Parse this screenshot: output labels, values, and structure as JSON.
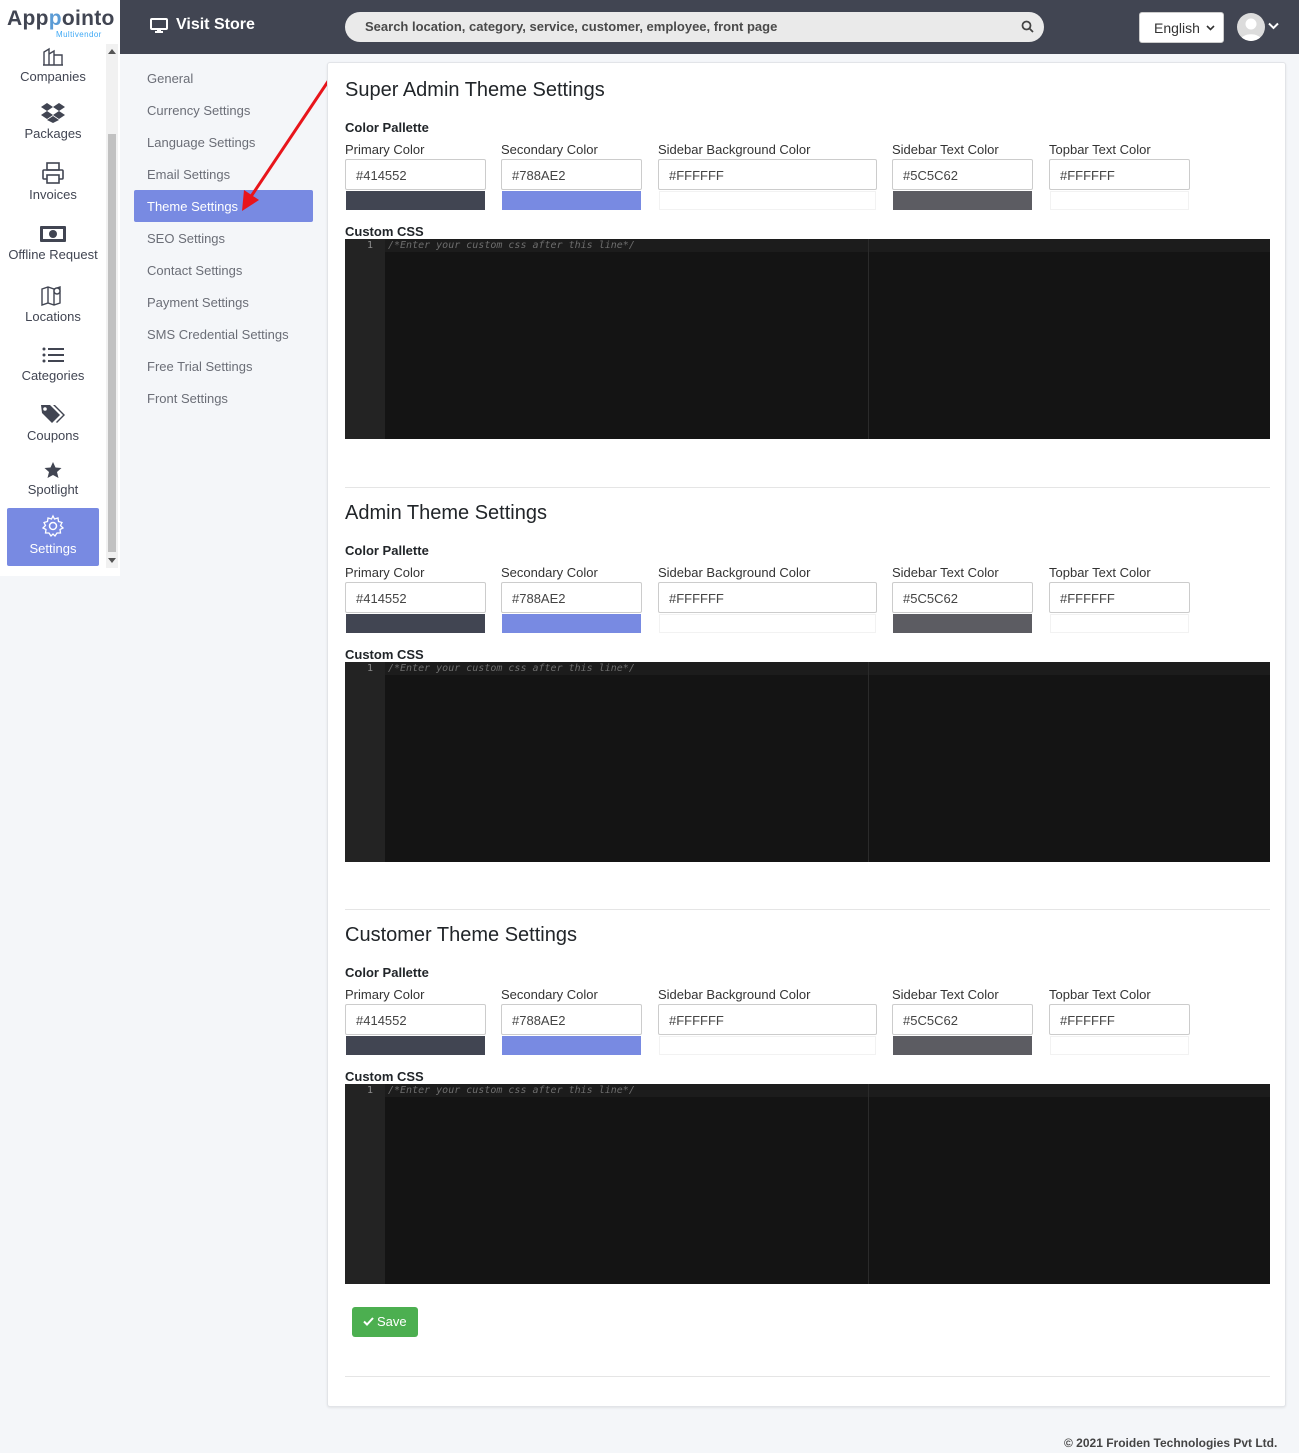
{
  "brand": {
    "name_a": "App",
    "name_b": "p",
    "name_c": "ointo",
    "sub": "Multivendor"
  },
  "topbar": {
    "visit_store": "Visit Store",
    "search_placeholder": "Search location, category, service, customer, employee, front page",
    "language": "English"
  },
  "nav": [
    {
      "label": "Companies",
      "icon": "building-icon"
    },
    {
      "label": "Packages",
      "icon": "dropbox-icon"
    },
    {
      "label": "Invoices",
      "icon": "printer-icon"
    },
    {
      "label": "Offline Request",
      "icon": "money-icon"
    },
    {
      "label": "Locations",
      "icon": "map-icon"
    },
    {
      "label": "Categories",
      "icon": "list-icon"
    },
    {
      "label": "Coupons",
      "icon": "tags-icon"
    },
    {
      "label": "Spotlight",
      "icon": "star-icon"
    },
    {
      "label": "Settings",
      "icon": "gear-icon",
      "active": true
    }
  ],
  "settings_menu": [
    "General",
    "Currency Settings",
    "Language Settings",
    "Email Settings",
    "Theme Settings",
    "SEO Settings",
    "Contact Settings",
    "Payment Settings",
    "SMS Credential Settings",
    "Free Trial Settings",
    "Front Settings"
  ],
  "settings_active": "Theme Settings",
  "labels": {
    "color_pallette": "Color Pallette",
    "custom_css": "Custom CSS",
    "primary": "Primary Color",
    "secondary": "Secondary Color",
    "sidebar_bg": "Sidebar Background Color",
    "sidebar_text": "Sidebar Text Color",
    "topbar_text": "Topbar Text Color",
    "css_placeholder": "/*Enter your custom css after this line*/",
    "line_no": "1"
  },
  "sections": [
    {
      "title": "Super Admin Theme Settings",
      "primary": "#414552",
      "secondary": "#788AE2",
      "sidebar_bg": "#FFFFFF",
      "sidebar_text": "#5C5C62",
      "topbar_text": "#FFFFFF"
    },
    {
      "title": "Admin Theme Settings",
      "primary": "#414552",
      "secondary": "#788AE2",
      "sidebar_bg": "#FFFFFF",
      "sidebar_text": "#5C5C62",
      "topbar_text": "#FFFFFF"
    },
    {
      "title": "Customer Theme Settings",
      "primary": "#414552",
      "secondary": "#788AE2",
      "sidebar_bg": "#FFFFFF",
      "sidebar_text": "#5C5C62",
      "topbar_text": "#FFFFFF"
    }
  ],
  "save_label": "Save",
  "footer": "© 2021 Froiden Technologies Pvt Ltd.",
  "colors": {
    "topbar": "#414552",
    "accent": "#788AE2",
    "save": "#4CAF50",
    "annotation_arrow": "#E8151B"
  }
}
